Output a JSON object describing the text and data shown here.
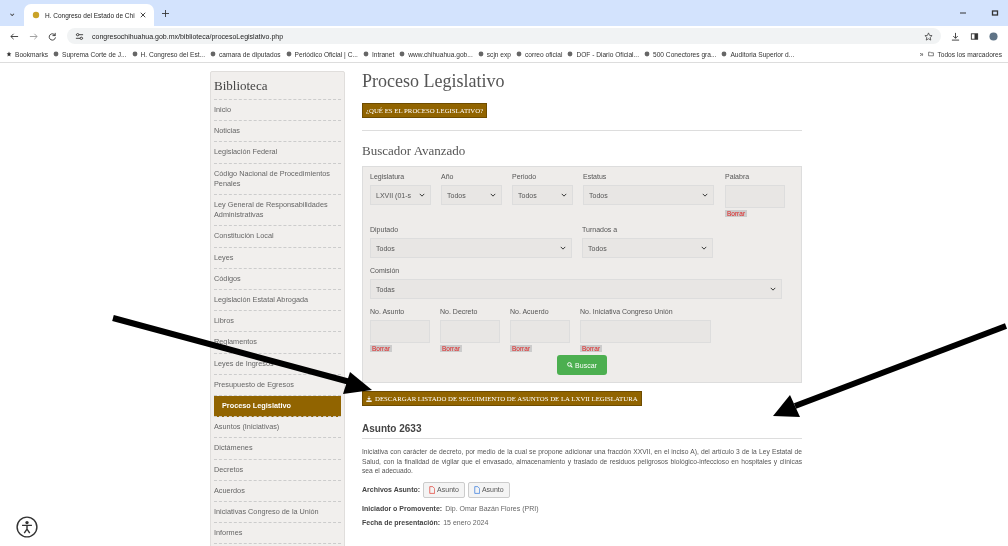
{
  "browser": {
    "tab_menu": "⌄",
    "tab_title": "H. Congreso del Estado de Chi",
    "url": "congresochihuahua.gob.mx/biblioteca/procesoLegislativo.php",
    "bookmarks": [
      "Bookmarks",
      "Suprema Corte de J...",
      "H. Congreso del Est...",
      "camara de diputados",
      "Periódico Oficial | C...",
      "Intranet",
      "www.chihuahua.gob...",
      "scjn exp",
      "correo oficial",
      "DOF - Diario Oficial...",
      "500 Conectores gra...",
      "Auditoria Superior d..."
    ],
    "more": "»",
    "all_bookmarks": "Todos los marcadores"
  },
  "sidebar": {
    "title": "Biblioteca",
    "items": [
      {
        "label": "Inicio",
        "selected": false
      },
      {
        "label": "Noticias",
        "selected": false
      },
      {
        "label": "Legislación Federal",
        "selected": false
      },
      {
        "label": "Código Nacional de Procedimientos Penales",
        "selected": false
      },
      {
        "label": "Ley General de Responsabilidades Administrativas",
        "selected": false
      },
      {
        "label": "Constitución Local",
        "selected": false
      },
      {
        "label": "Leyes",
        "selected": false
      },
      {
        "label": "Códigos",
        "selected": false
      },
      {
        "label": "Legislación Estatal Abrogada",
        "selected": false
      },
      {
        "label": "Libros",
        "selected": false
      },
      {
        "label": "Reglamentos",
        "selected": false
      },
      {
        "label": "Leyes de Ingresos",
        "selected": false
      },
      {
        "label": "Presupuesto de Egresos",
        "selected": false
      },
      {
        "label": "Proceso Legislativo",
        "selected": true
      },
      {
        "label": "Asuntos (Iniciativas)",
        "selected": false
      },
      {
        "label": "Dictámenes",
        "selected": false
      },
      {
        "label": "Decretos",
        "selected": false
      },
      {
        "label": "Acuerdos",
        "selected": false
      },
      {
        "label": "Iniciativas Congreso de la Unión",
        "selected": false
      },
      {
        "label": "Informes",
        "selected": false
      }
    ]
  },
  "title": "Proceso Legislativo",
  "what_button": "¿QUÉ ES EL PROCESO LEGISLATIVO?",
  "search": {
    "title": "Buscador Avanzado",
    "row1": [
      {
        "label": "Legislatura",
        "value": "LXVII (01-s",
        "kind": "select"
      },
      {
        "label": "Año",
        "value": "Todos",
        "kind": "select"
      },
      {
        "label": "Periodo",
        "value": "Todos",
        "kind": "select"
      },
      {
        "label": "Estatus",
        "value": "Todos",
        "kind": "select"
      },
      {
        "label": "Palabra",
        "kind": "text",
        "clear": "Borrar"
      }
    ],
    "row2": [
      {
        "label": "Diputado",
        "value": "Todos"
      },
      {
        "label": "Turnados a",
        "value": "Todos"
      }
    ],
    "row3": {
      "label": "Comisión",
      "value": "Todas"
    },
    "row4": [
      {
        "label": "No. Asunto",
        "clear": "Borrar"
      },
      {
        "label": "No. Decreto",
        "clear": "Borrar"
      },
      {
        "label": "No. Acuerdo",
        "clear": "Borrar"
      },
      {
        "label": "No. Iniciativa Congreso Unión",
        "clear": "Borrar"
      }
    ],
    "button": "Buscar"
  },
  "download_button": "DESCARGAR LISTADO DE SEGUIMIENTO DE ASUNTOS DE LA LXVII LEGISLATURA",
  "asunto": {
    "title": "Asunto 2633",
    "description": "Iniciativa con carácter de decreto, por medio de la cual se propone adicionar una fracción XXVII, en el inciso A), del artículo 3 de la Ley Estatal de Salud, con la finalidad de vigilar que el envasado, almacenamiento y traslado de residuos peligrosos biológico-infeccioso en hospitales y clínicas sea el adecuado.",
    "files_label": "Archivos Asunto:",
    "files": [
      {
        "label": "Asunto",
        "kind": "pdf"
      },
      {
        "label": "Asunto",
        "kind": "doc"
      }
    ],
    "fields": [
      {
        "label": "Iniciador o Promovente:",
        "value": "Dip. Omar Bazán Flores (PRI)"
      },
      {
        "label": "Fecha de presentación:",
        "value": "15 enero 2024"
      }
    ]
  }
}
